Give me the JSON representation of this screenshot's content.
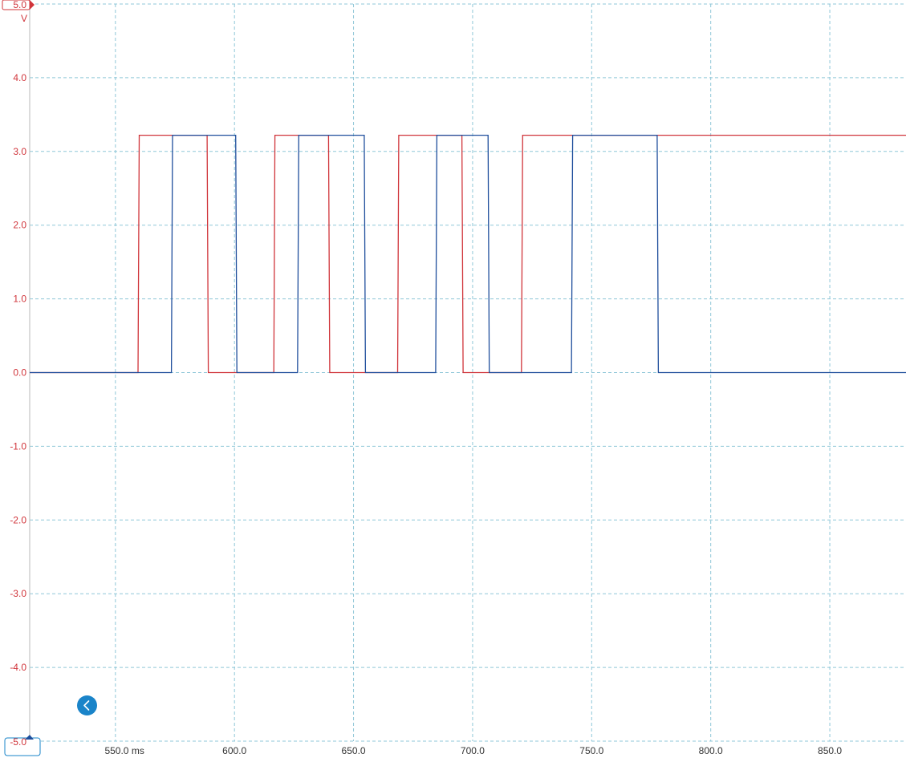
{
  "chart_data": {
    "type": "line",
    "title": "",
    "xlabel": "",
    "ylabel": "V",
    "x_unit": "ms",
    "xlim": [
      514,
      882
    ],
    "ylim": [
      -5.0,
      5.0
    ],
    "x_ticks": [
      {
        "value": 550,
        "label": "550.0 ms"
      },
      {
        "value": 600,
        "label": "600.0"
      },
      {
        "value": 650,
        "label": "650.0"
      },
      {
        "value": 700,
        "label": "700.0"
      },
      {
        "value": 750,
        "label": "750.0"
      },
      {
        "value": 800,
        "label": "800.0"
      },
      {
        "value": 850,
        "label": "850.0"
      }
    ],
    "y_ticks": [
      {
        "value": 4.0,
        "label": "4.0"
      },
      {
        "value": 3.0,
        "label": "3.0"
      },
      {
        "value": 2.0,
        "label": "2.0"
      },
      {
        "value": 1.0,
        "label": "1.0"
      },
      {
        "value": 0.0,
        "label": "0.0"
      },
      {
        "value": -1.0,
        "label": "-1.0"
      },
      {
        "value": -2.0,
        "label": "-2.0"
      },
      {
        "value": -3.0,
        "label": "-3.0"
      },
      {
        "value": -4.0,
        "label": "-4.0"
      }
    ],
    "y_top_label": "5.0",
    "y_bottom_label": "-5.0",
    "grid": true,
    "series": [
      {
        "color": "#d0343a",
        "x": [
          514,
          559.5,
          560,
          588.5,
          589,
          616.5,
          617,
          639.5,
          640,
          668.5,
          669,
          695.5,
          696,
          720.5,
          721,
          882
        ],
        "y": [
          0.0,
          0.0,
          3.22,
          3.22,
          0.0,
          0.0,
          3.22,
          3.22,
          0.0,
          0.0,
          3.22,
          3.22,
          0.0,
          0.0,
          3.22,
          3.22
        ]
      },
      {
        "color": "#1f4e9c",
        "x": [
          514,
          573.5,
          574,
          600.5,
          601,
          626.5,
          627,
          654.5,
          655,
          684.5,
          685,
          706.5,
          707,
          741.5,
          742,
          777.5,
          778,
          882
        ],
        "y": [
          0.0,
          0.0,
          3.22,
          3.22,
          0.0,
          0.0,
          3.22,
          3.22,
          0.0,
          0.0,
          3.22,
          3.22,
          0.0,
          0.0,
          3.22,
          3.22,
          0.0,
          0.0
        ]
      }
    ]
  },
  "ui": {
    "collapse_icon": "chevron-left-icon",
    "accent_color": "#1a84c9"
  }
}
